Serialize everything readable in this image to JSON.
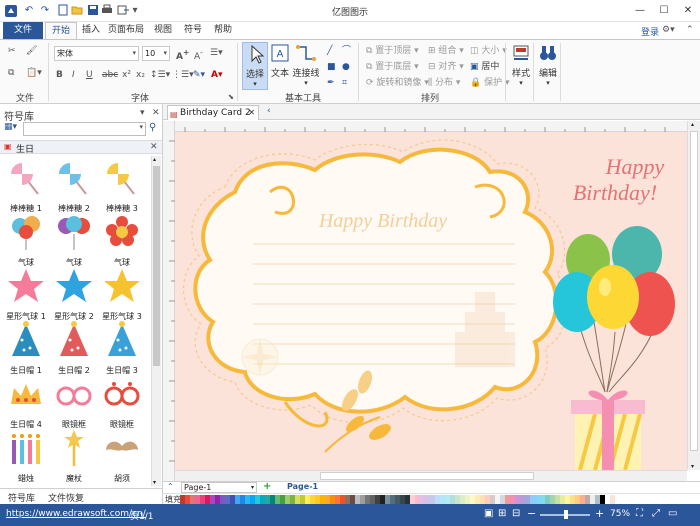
{
  "app": {
    "title": "亿图图示"
  },
  "quick_access": [
    "undo-icon",
    "redo-icon",
    "open-icon",
    "save-icon",
    "print-icon",
    "export-icon"
  ],
  "tabs": [
    {
      "label": "文件"
    },
    {
      "label": "开始"
    },
    {
      "label": "插入"
    },
    {
      "label": "页面布局"
    },
    {
      "label": "视图"
    },
    {
      "label": "符号"
    },
    {
      "label": "帮助"
    }
  ],
  "account": {
    "login": "登录"
  },
  "ribbon": {
    "groups": {
      "file": "文件",
      "font": "字体",
      "basic_tools": "基本工具",
      "arrange": "排列"
    },
    "font_name": "宋体",
    "font_size": "10",
    "tools": {
      "select": "选择",
      "text": "文本",
      "connector": "连接线"
    },
    "arrange": {
      "bring_front": "置于顶层",
      "send_back": "置于底层",
      "rotate_mirror": "旋转和镜像",
      "group": "组合",
      "align": "对齐",
      "distribute": "分布",
      "size": "大小",
      "center": "居中",
      "protect": "保护"
    },
    "style": "样式",
    "edit": "编辑"
  },
  "library": {
    "title": "符号库",
    "category": "生日",
    "symbols": [
      {
        "label": "棒棒糖 1"
      },
      {
        "label": "棒棒糖 2"
      },
      {
        "label": "棒棒糖 3"
      },
      {
        "label": "气球"
      },
      {
        "label": "气球"
      },
      {
        "label": "气球"
      },
      {
        "label": "星形气球 1"
      },
      {
        "label": "星形气球 2"
      },
      {
        "label": "星形气球 3"
      },
      {
        "label": "生日帽 1"
      },
      {
        "label": "生日帽 2"
      },
      {
        "label": "生日帽 3"
      },
      {
        "label": "生日帽 4"
      },
      {
        "label": "眼镜框"
      },
      {
        "label": "眼镜框"
      },
      {
        "label": "蜡烛"
      },
      {
        "label": "魔杖"
      },
      {
        "label": "胡须"
      }
    ],
    "bottom_tabs": {
      "symbols": "符号库",
      "recovery": "文件恢复"
    }
  },
  "document": {
    "tab": "Birthday Card 2"
  },
  "card": {
    "frame_text": "Happy Birthday",
    "corner_line1": "Happy",
    "corner_line2": "Birthday!"
  },
  "pages": {
    "selector": "Page-1",
    "active": "Page-1"
  },
  "fill": {
    "label": "填充"
  },
  "status": {
    "url": "https://www.edrawsoft.com/cn/",
    "page": "页1/1",
    "zoom": "75%"
  },
  "colors": {
    "accent": "#2b579a",
    "canvas": "#fbe3da",
    "frame": "#f6b93b",
    "heading": "#e57373"
  }
}
